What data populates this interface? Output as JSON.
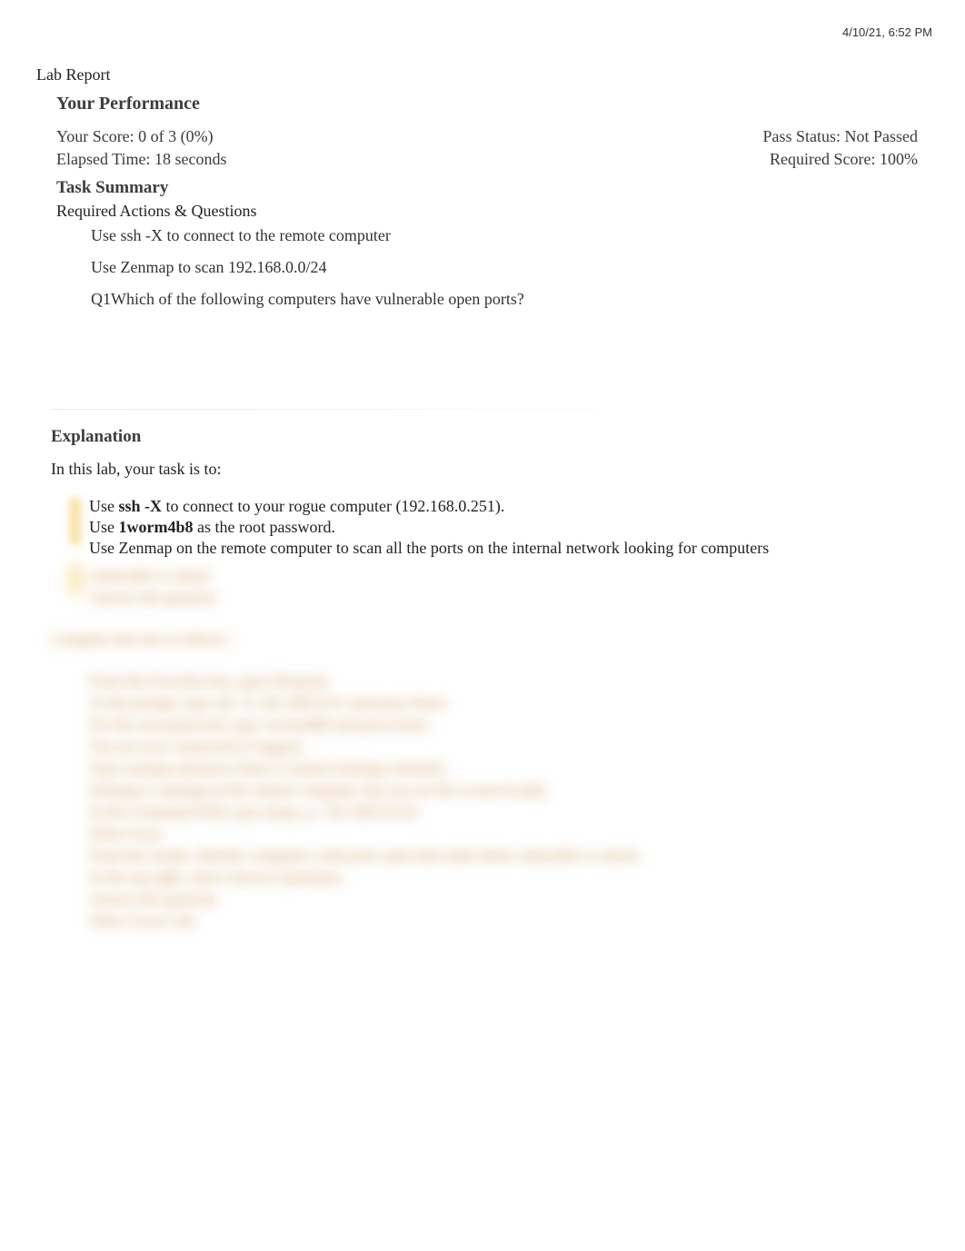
{
  "meta": {
    "timestamp": "4/10/21, 6:52 PM"
  },
  "doc_title": "Lab Report",
  "performance": {
    "heading": "Your Performance",
    "score_label": "Your Score: 0 of 3 (0%)",
    "pass_label": "Pass Status: Not Passed",
    "elapsed_label": "Elapsed Time: 18 seconds",
    "required_label": "Required Score: 100%"
  },
  "task_summary": {
    "heading": "Task Summary",
    "subheading": "Required Actions & Questions",
    "items": [
      "Use ssh -X to connect to the remote computer",
      "Use Zenmap to scan 192.168.0.0/24",
      "Q1Which of the following computers have vulnerable open ports?"
    ]
  },
  "explanation": {
    "heading": "Explanation",
    "intro": "In this lab, your task is to:",
    "bullets": {
      "b1_pre": "Use ",
      "b1_bold": "ssh -X",
      "b1_post": " to connect to your rogue computer (192.168.0.251).",
      "b2_pre": "Use ",
      "b2_bold": "1worm4b8",
      "b2_post": " as the root password.",
      "b3": "Use Zenmap on the remote computer to scan all the ports on the internal network looking for computers"
    },
    "blurred": [
      "vulnerable to attack",
      "Answer the question",
      "",
      "Complete this lab as follows:",
      "",
      "From the Favorites bar, open Terminal.",
      "At the prompt, type ssh -X 192.168.0.251 and press Enter.",
      "For the root password, type 1worm4b8 and press Enter.",
      "You are now connected to Support.",
      "Type zenmap and press Enter to launch Zenmap remotely.",
      "Zenmap is running on the remote computer, but you see the screen locally.",
      "In the Command field, type nmap -p- 192.168.0.0/24.",
      "Select Scan.",
      "From the results, find the computers with ports open that make them vulnerable to attack.",
      "In the top right, select Answer Questions.",
      "Answer the question.",
      "Select Score Lab."
    ]
  }
}
